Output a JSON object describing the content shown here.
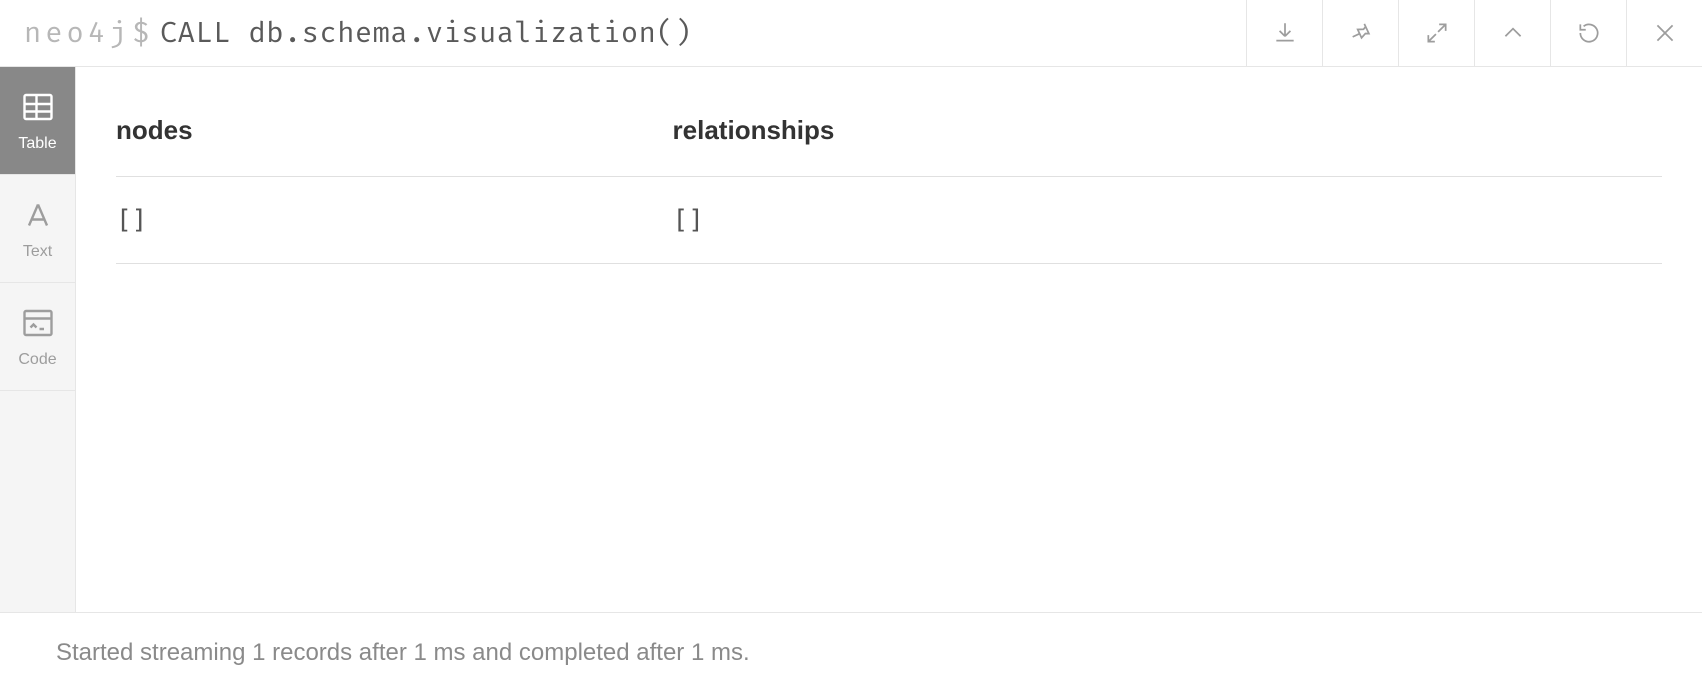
{
  "prompt": {
    "db": "neo4j",
    "symbol": "$"
  },
  "query": "CALL db.schema.visualization()",
  "sidebar": {
    "tabs": [
      {
        "label": "Table"
      },
      {
        "label": "Text"
      },
      {
        "label": "Code"
      }
    ]
  },
  "table": {
    "headers": [
      "nodes",
      "relationships"
    ],
    "rows": [
      [
        "[]",
        "[]"
      ]
    ]
  },
  "footer": "Started streaming 1 records after 1 ms and completed after 1 ms."
}
